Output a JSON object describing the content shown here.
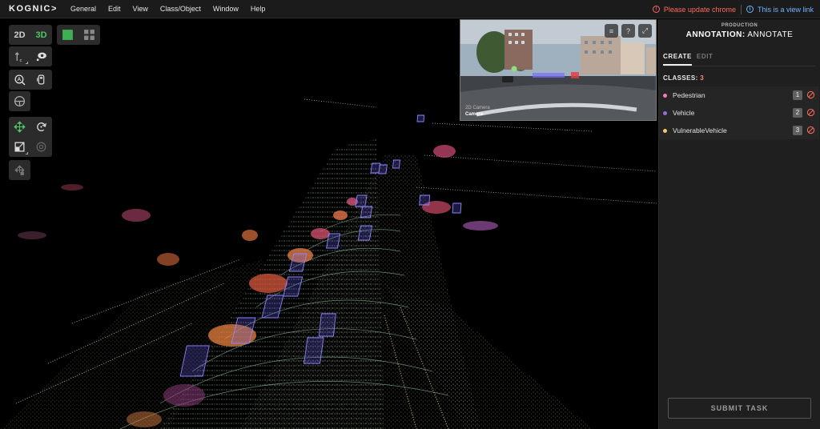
{
  "app": {
    "logo": "KOGNIC>",
    "menu": [
      "General",
      "Edit",
      "View",
      "Class/Object",
      "Window",
      "Help"
    ],
    "notice_warning": "Please update chrome",
    "notice_info": "This is a view link",
    "warning_icon": "alert-circle-icon",
    "info_icon": "info-circle-icon"
  },
  "toolbar": {
    "view_2d": "2D",
    "view_3d": "3D",
    "active_view": "3D",
    "tools": [
      "pointer-icon",
      "eye-icon",
      "auto-annotate-icon",
      "vehicle-side-icon",
      "steering-wheel-icon",
      "move-icon",
      "rotate-icon",
      "scale-icon",
      "lock-rotate-icon",
      "add-point-icon"
    ]
  },
  "camera": {
    "sensor_label": "2D Camera",
    "camera_name": "Camera",
    "tools": [
      "adjust-icon",
      "help-icon",
      "expand-icon"
    ]
  },
  "panel": {
    "environment": "PRODUCTION",
    "title_bold": "ANNOTATION:",
    "title_rest": "ANNOTATE",
    "tabs": [
      "CREATE",
      "EDIT"
    ],
    "active_tab": "CREATE",
    "classes_label": "CLASSES:",
    "classes_count": "3",
    "classes": [
      {
        "name": "Pedestrian",
        "hotkey": "1",
        "color": "#f27fb8"
      },
      {
        "name": "Vehicle",
        "hotkey": "2",
        "color": "#9a6bd4"
      },
      {
        "name": "VulnerableVehicle",
        "hotkey": "3",
        "color": "#f2c96b"
      }
    ],
    "submit_label": "SUBMIT TASK"
  },
  "colors": {
    "accent_green": "#52c46a",
    "warning_red": "#ff6a5c",
    "info_blue": "#6fb6ff",
    "box_purple": "#7a74ff"
  }
}
